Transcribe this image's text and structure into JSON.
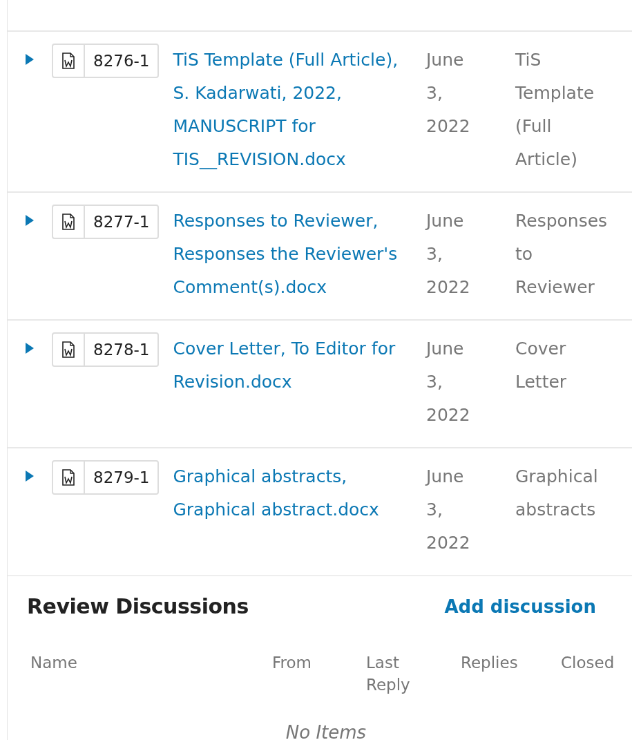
{
  "files": [
    {
      "expanded": false,
      "id": "8276-1",
      "name": "TiS Template (Full Article), S. Kadarwati, 2022, MANUSCRIPT for TIS__REVISION.docx",
      "date": "June 3, 2022",
      "type": "TiS Template (Full Article)"
    },
    {
      "expanded": false,
      "id": "8277-1",
      "name": "Responses to Reviewer, Responses the Reviewer's Comment(s).docx",
      "date": "June 3, 2022",
      "type": "Responses to Reviewer"
    },
    {
      "expanded": false,
      "id": "8278-1",
      "name": "Cover Letter, To Editor for Revision.docx",
      "date": "June 3, 2022",
      "type": "Cover Letter"
    },
    {
      "expanded": false,
      "id": "8279-1",
      "name": "Graphical abstracts, Graphical abstract.docx",
      "date": "June 3, 2022",
      "type": "Graphical abstracts"
    }
  ],
  "discussions": {
    "title": "Review Discussions",
    "action": "Add discussion",
    "columns": [
      "Name",
      "From",
      "Last Reply",
      "Replies",
      "Closed"
    ],
    "empty": "No Items"
  }
}
